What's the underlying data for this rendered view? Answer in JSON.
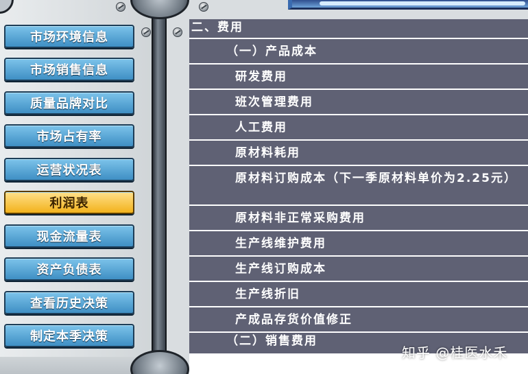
{
  "menu": {
    "items": [
      {
        "label": "市场环境信息",
        "active": false
      },
      {
        "label": "市场销售信息",
        "active": false
      },
      {
        "label": "质量品牌对比",
        "active": false
      },
      {
        "label": "市场占有率",
        "active": false
      },
      {
        "label": "运营状况表",
        "active": false
      },
      {
        "label": "利润表",
        "active": true
      },
      {
        "label": "现金流量表",
        "active": false
      },
      {
        "label": "资产负债表",
        "active": false
      },
      {
        "label": "查看历史决策",
        "active": false
      },
      {
        "label": "制定本季决策",
        "active": false
      }
    ]
  },
  "report": {
    "rows": [
      {
        "text": "二、费用",
        "level": 0
      },
      {
        "text": "（一）产品成本",
        "level": 1
      },
      {
        "text": "研发费用",
        "level": 2
      },
      {
        "text": "班次管理费用",
        "level": 2
      },
      {
        "text": "人工费用",
        "level": 2
      },
      {
        "text": "原材料耗用",
        "level": 2
      },
      {
        "text": "原材料订购成本（下一季原材料单价为2.25元）",
        "level": "multi"
      },
      {
        "text": "原材料非正常采购费用",
        "level": 2
      },
      {
        "text": "生产线维护费用",
        "level": 2
      },
      {
        "text": "生产线订购成本",
        "level": 2
      },
      {
        "text": "生产线折旧",
        "level": 2
      },
      {
        "text": "产成品存货价值修正",
        "level": 2
      },
      {
        "text": "（二）销售费用",
        "level": "partial"
      }
    ]
  },
  "watermark": "知乎 @桂医水禾",
  "colors": {
    "row_bg": "#5f6174",
    "button_blue": "#3f8fc4",
    "button_active": "#f2b21c"
  }
}
